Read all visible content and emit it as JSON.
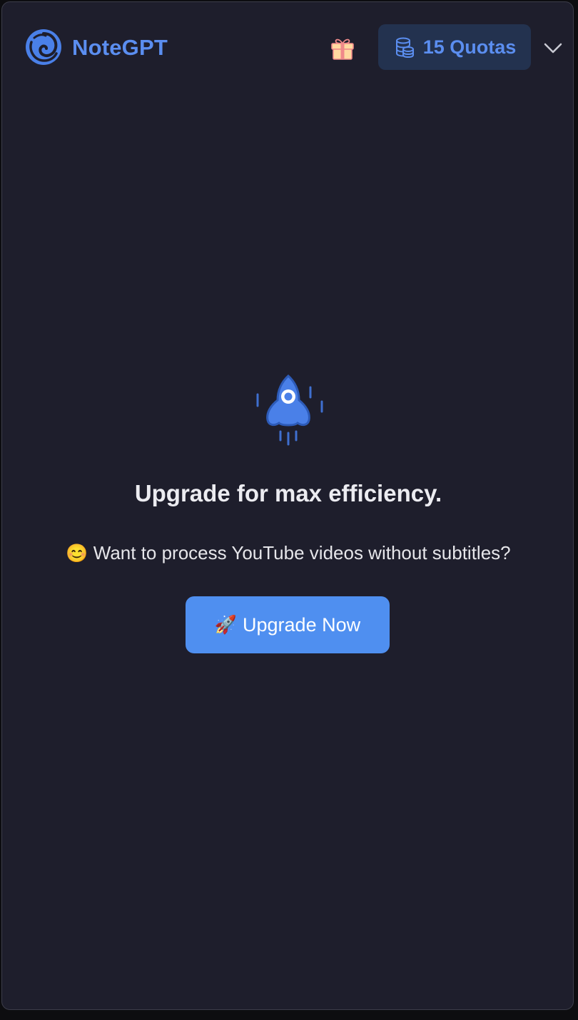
{
  "header": {
    "brand": "NoteGPT",
    "quota_label": "15 Quotas",
    "accent_color": "#5b8ef0",
    "icons": [
      "notegpt-logo-icon",
      "gift-icon",
      "coins-stack-icon",
      "chevron-down-icon"
    ]
  },
  "main": {
    "icon": "rocket-icon",
    "title": "Upgrade for max efficiency.",
    "subtitle_emoji": "😊",
    "subtitle": "Want to process YouTube videos without subtitles?",
    "cta_emoji": "🚀",
    "cta_label": "Upgrade Now",
    "cta_color": "#4f8ff0"
  }
}
